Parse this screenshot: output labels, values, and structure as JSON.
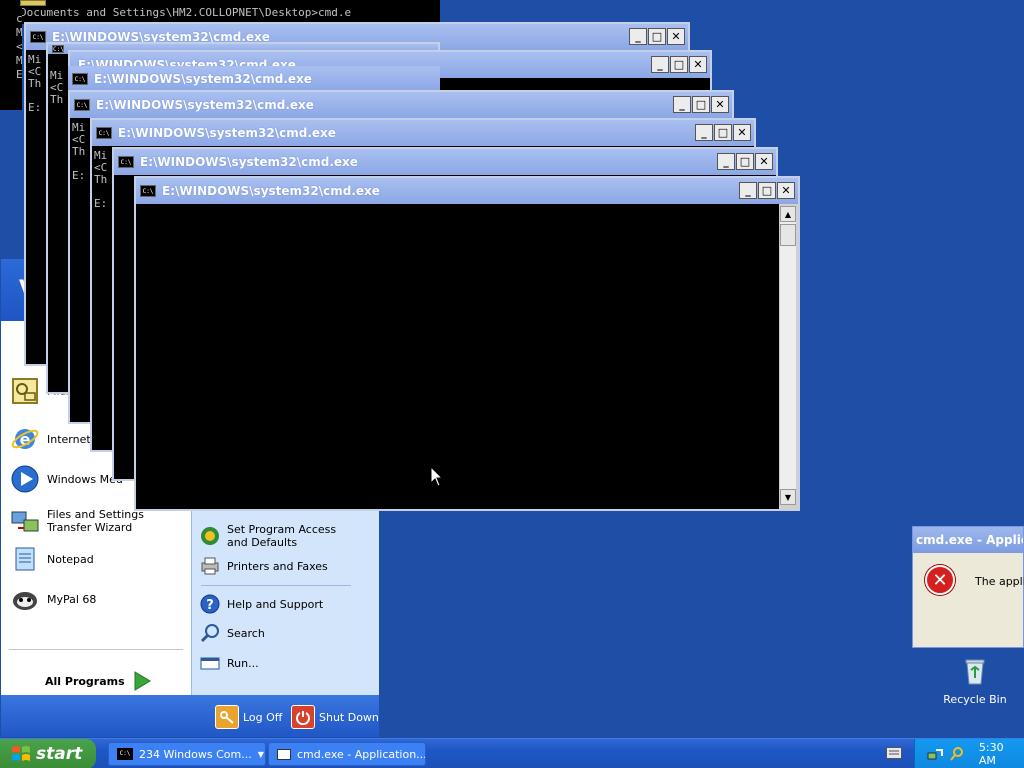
{
  "back_console": {
    "line1": "Documents and Settings\\HM2.COLLOPNET\\Desktop>cmd.e",
    "left_lines": [
      "c",
      "M",
      "<",
      "M",
      "E"
    ]
  },
  "cmd_windows": [
    {
      "title": "E:\\WINDOWS\\system32\\cmd.exe",
      "lines": [
        "",
        "Mi",
        "<C",
        "Th",
        "",
        "E:"
      ]
    },
    {
      "title": "E:\\WINDOWS\\system32\\cmd.exe",
      "lines": [
        "",
        "Mi",
        "<C",
        "Th",
        "",
        "E:"
      ]
    },
    {
      "title": "E:\\WINDOWS\\system32\\cmd.exe",
      "lines": [
        "",
        "Mi",
        "<C",
        "Th",
        "",
        "E:"
      ]
    },
    {
      "title": "E:\\WINDOWS\\system32\\cmd.exe",
      "lines": [
        "",
        "Mi",
        "<C",
        "Th",
        "",
        "E:"
      ]
    },
    {
      "title": "E:\\WINDOWS\\system32\\cmd.exe",
      "lines": [
        "Mi",
        "<C",
        "Th",
        "",
        "E:"
      ]
    },
    {
      "title": "E:\\WINDOWS\\system32\\cmd.exe",
      "lines": [
        "Mi",
        "<C",
        "Th",
        "",
        "E:"
      ]
    },
    {
      "title": "E:\\WINDOWS\\system32\\cmd.exe",
      "lines": []
    }
  ],
  "window_buttons": {
    "minimize": "_",
    "maximize": "□",
    "close": "✕"
  },
  "start_menu": {
    "header_letter": "V",
    "left_items": [
      {
        "label": "Micr",
        "icon": "outlook-icon"
      },
      {
        "label": "Internet",
        "icon": "internet-explorer-icon"
      },
      {
        "label": "Windows Med",
        "icon": "media-player-icon"
      },
      {
        "label": "Files and Settings Transfer Wizard",
        "icon": "transfer-wizard-icon"
      },
      {
        "label": "Notepad",
        "icon": "notepad-icon"
      },
      {
        "label": "MyPal 68",
        "icon": "mypal-icon"
      }
    ],
    "all_programs": "All Programs",
    "right_items": [
      {
        "label": "Set Program Access and Defaults",
        "icon": "program-access-icon"
      },
      {
        "label": "Printers and Faxes",
        "icon": "printer-icon"
      },
      {
        "label": "Help and Support",
        "icon": "help-icon"
      },
      {
        "label": "Search",
        "icon": "search-icon"
      },
      {
        "label": "Run...",
        "icon": "run-icon"
      }
    ],
    "log_off": "Log Off",
    "shut_down": "Shut Down"
  },
  "error_dialog": {
    "title": "cmd.exe - Applica",
    "message": "The applic"
  },
  "desktop": {
    "recycle_bin": "Recycle Bin"
  },
  "taskbar": {
    "start_label": "start",
    "tasks": [
      {
        "label": "234 Windows Com..."
      },
      {
        "label": "cmd.exe - Application..."
      }
    ],
    "clock": "5:30 AM"
  },
  "colors": {
    "desktop": "#1f4ea6",
    "taskbar": "#1e57c5",
    "start_button": "#3a8c36"
  }
}
